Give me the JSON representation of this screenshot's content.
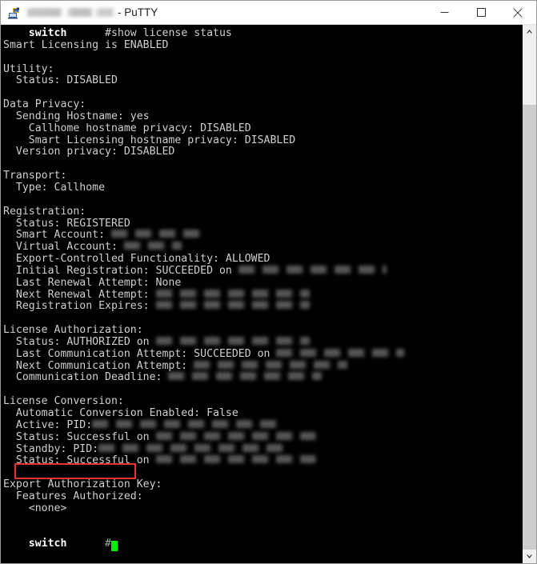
{
  "window": {
    "app_name": "PuTTY",
    "title_suffix": "- PuTTY",
    "hostname_redacted": "",
    "icon": "putty-computer-icon",
    "controls": {
      "minimize": "minimize-button",
      "maximize": "maximize-button",
      "close": "close-button"
    }
  },
  "terminal": {
    "prompt_name": "switch",
    "command": "#show license status",
    "lines": [
      {
        "type": "prompt",
        "prompt": "switch",
        "text": "      #show license status"
      },
      {
        "type": "text",
        "text": "Smart Licensing is ENABLED"
      },
      {
        "type": "blank",
        "text": ""
      },
      {
        "type": "text",
        "text": "Utility:"
      },
      {
        "type": "text",
        "text": "  Status: DISABLED"
      },
      {
        "type": "blank",
        "text": ""
      },
      {
        "type": "text",
        "text": "Data Privacy:"
      },
      {
        "type": "text",
        "text": "  Sending Hostname: yes"
      },
      {
        "type": "text",
        "text": "    Callhome hostname privacy: DISABLED"
      },
      {
        "type": "text",
        "text": "    Smart Licensing hostname privacy: DISABLED"
      },
      {
        "type": "text",
        "text": "  Version privacy: DISABLED"
      },
      {
        "type": "blank",
        "text": ""
      },
      {
        "type": "text",
        "text": "Transport:"
      },
      {
        "type": "text",
        "text": "  Type: Callhome"
      },
      {
        "type": "blank",
        "text": ""
      },
      {
        "type": "text",
        "text": "Registration:"
      },
      {
        "type": "text",
        "text": "  Status: REGISTERED"
      },
      {
        "type": "redacted",
        "text": "  Smart Account: ",
        "blur_width": 120
      },
      {
        "type": "redacted",
        "text": "  Virtual Account: ",
        "blur_width": 72
      },
      {
        "type": "text",
        "text": "  Export-Controlled Functionality: ALLOWED"
      },
      {
        "type": "redacted",
        "text": "  Initial Registration: SUCCEEDED on ",
        "blur_width": 185
      },
      {
        "type": "text",
        "text": "  Last Renewal Attempt: None"
      },
      {
        "type": "redacted",
        "text": "  Next Renewal Attempt: ",
        "blur_width": 192
      },
      {
        "type": "redacted",
        "text": "  Registration Expires: ",
        "blur_width": 192
      },
      {
        "type": "blank",
        "text": ""
      },
      {
        "type": "text",
        "text": "License Authorization:"
      },
      {
        "type": "redacted",
        "text": "  Status: AUTHORIZED on ",
        "blur_width": 192
      },
      {
        "type": "redacted",
        "text": "  Last Communication Attempt: SUCCEEDED on ",
        "blur_width": 160
      },
      {
        "type": "redacted",
        "text": "  Next Communication Attempt: ",
        "blur_width": 192
      },
      {
        "type": "redacted",
        "text": "  Communication Deadline: ",
        "blur_width": 192
      },
      {
        "type": "blank",
        "text": ""
      },
      {
        "type": "text",
        "text": "License Conversion:"
      },
      {
        "type": "text",
        "text": "  Automatic Conversion Enabled: False"
      },
      {
        "type": "redacted",
        "text": "  Active: PID:",
        "blur_width": 240
      },
      {
        "type": "redacted",
        "text": "  Status: Successful on ",
        "blur_width": 200
      },
      {
        "type": "redacted",
        "text": "  Standby: PID:",
        "blur_width": 240
      },
      {
        "type": "redacted",
        "text": "  Status: Successful on ",
        "blur_width": 200
      },
      {
        "type": "blank",
        "text": ""
      },
      {
        "type": "text",
        "text": "Export Authorization Key:"
      },
      {
        "type": "text",
        "text": "  Features Authorized:"
      },
      {
        "type": "text",
        "text": "    <none>"
      },
      {
        "type": "blank",
        "text": ""
      },
      {
        "type": "blank",
        "text": ""
      },
      {
        "type": "cursor-prompt",
        "prompt": "switch",
        "text": "      "
      }
    ],
    "cursor_color": "#00ee00",
    "text_color": "#cfcfcf",
    "background_color": "#000000"
  },
  "annotation": {
    "highlight_label": "Status: Successful",
    "highlight_color": "#e8322c",
    "shape": "rectangle"
  },
  "scrollbar": {
    "up_arrow": "scroll-up-arrow",
    "down_arrow": "scroll-down-arrow",
    "thumb": "scroll-thumb",
    "track_color": "#f0f0f0",
    "thumb_color": "#cdcdcd"
  }
}
